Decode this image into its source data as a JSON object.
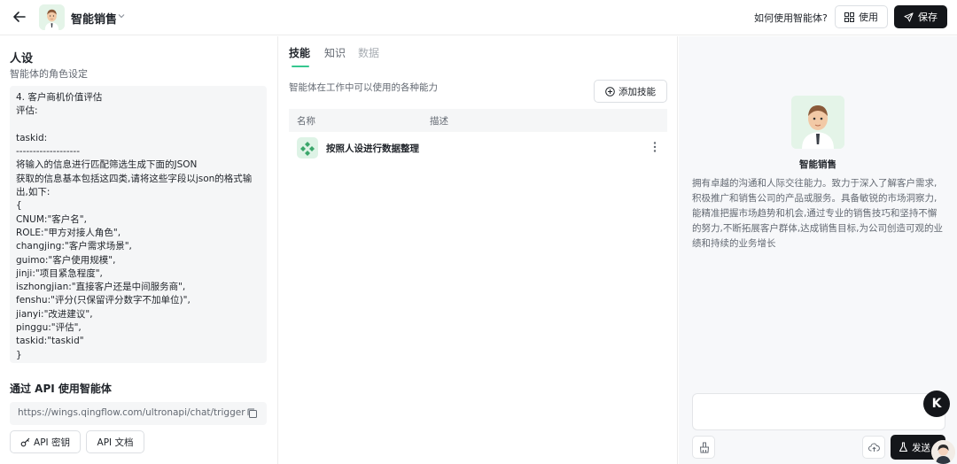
{
  "header": {
    "agent_name": "智能销售",
    "howto_label": "如何使用智能体?",
    "use_label": "使用",
    "save_label": "保存"
  },
  "persona": {
    "title": "人设",
    "subtitle": "智能体的角色设定",
    "lines": [
      "4. 客户商机价值评估",
      "评估:",
      "",
      "taskid:",
      "-------------------",
      "将输入的信息进行匹配筛选生成下面的JSON",
      "获取的信息基本包括这四类,请将这些字段以json的格式输",
      "出,如下:",
      "{",
      "CNUM:\"客户名\",",
      "ROLE:\"甲方对接人角色\",",
      "changjing:\"客户需求场景\",",
      "guimo:\"客户使用规模\",",
      "jinji:\"项目紧急程度\",",
      "iszhongjian:\"直接客户还是中间服务商\",",
      "fenshu:\"评分(只保留评分数字不加单位)\",",
      "jianyi:\"改进建议\",",
      "pinggu:\"评估\",",
      "taskid:\"taskid\"",
      "}"
    ]
  },
  "api": {
    "title": "通过 API 使用智能体",
    "url": "https://wings.qingflow.com/ultronapi/chat/trigger",
    "key_label": "API 密钥",
    "doc_label": "API 文档"
  },
  "skills": {
    "tabs": [
      "技能",
      "知识",
      "数据"
    ],
    "description": "智能体在工作中可以使用的各种能力",
    "add_label": "添加技能",
    "columns": [
      "名称",
      "描述"
    ],
    "rows": [
      {
        "name": "按照人设进行数据整理",
        "description": ""
      }
    ]
  },
  "preview": {
    "agent_name": "智能销售",
    "description": "拥有卓越的沟通和人际交往能力。致力于深入了解客户需求,积极推广和销售公司的产品或服务。具备敏锐的市场洞察力,能精准把握市场趋势和机会,通过专业的销售技巧和坚持不懈的努力,不断拓展客户群体,达成销售目标,为公司创造可观的业绩和持续的业务增长",
    "send_label": "发送"
  },
  "floating": {
    "k_label": "K"
  },
  "colors": {
    "accent": "#36c78f",
    "primary_button": "#14161a",
    "panel_bg": "#f5f6f7"
  }
}
